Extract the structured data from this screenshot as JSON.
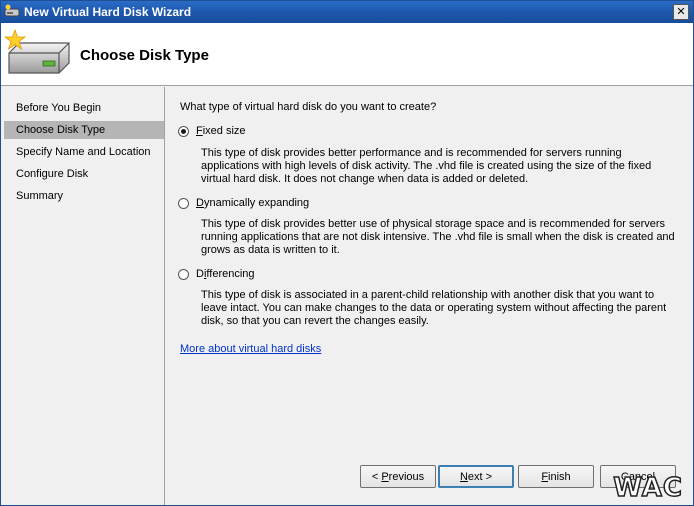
{
  "window": {
    "title": "New Virtual Hard Disk Wizard",
    "close_glyph": "✕"
  },
  "header": {
    "title": "Choose Disk Type"
  },
  "sidebar": {
    "steps": [
      {
        "label": "Before You Begin",
        "active": false
      },
      {
        "label": "Choose Disk Type",
        "active": true
      },
      {
        "label": "Specify Name and Location",
        "active": false
      },
      {
        "label": "Configure Disk",
        "active": false
      },
      {
        "label": "Summary",
        "active": false
      }
    ]
  },
  "main": {
    "question": "What type of virtual hard disk do you want to create?",
    "options": [
      {
        "label_prefix": "",
        "label_accel": "F",
        "label_rest": "ixed size",
        "checked": true,
        "description": "This type of disk provides better performance and is recommended for servers running applications with high levels of disk activity. The .vhd file is created using the size of the fixed virtual hard disk. It does not change when data is added or deleted."
      },
      {
        "label_prefix": "",
        "label_accel": "D",
        "label_rest": "ynamically expanding",
        "checked": false,
        "description": "This type of disk provides better use of physical storage space and is recommended for servers running applications that are not disk intensive. The .vhd file is small when the disk is created and grows as data is written to it."
      },
      {
        "label_prefix": "D",
        "label_accel": "i",
        "label_rest": "fferencing",
        "checked": false,
        "description": "This type of disk is associated in a parent-child relationship with another disk that you want to leave intact. You can make changes to the data or operating system without affecting the parent disk, so that you can revert the changes easily."
      }
    ],
    "more_link": "More about virtual hard disks"
  },
  "buttons": {
    "previous": {
      "prefix": "< ",
      "accel": "P",
      "rest": "revious"
    },
    "next": {
      "prefix": "",
      "accel": "N",
      "rest": "ext >"
    },
    "finish": {
      "prefix": "",
      "accel": "F",
      "rest": "inish"
    },
    "cancel": {
      "prefix": "",
      "accel": "",
      "rest": "Cancel"
    }
  },
  "watermark": "WAC",
  "colors": {
    "titlebar": "#1d58ad",
    "active_step": "#b5b5b5",
    "link": "#0033cc"
  }
}
